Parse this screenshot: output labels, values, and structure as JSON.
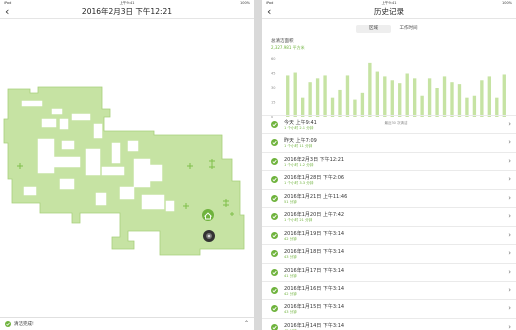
{
  "left": {
    "status": {
      "carrier": "iPad",
      "time": "上午9:41",
      "battery": "100%"
    },
    "nav": {
      "back": "‹",
      "title": "2016年2月3日 下午12:21"
    },
    "bottom": {
      "message": "清洁完成!",
      "chevron": "⌃"
    }
  },
  "right": {
    "status": {
      "carrier": "iPad",
      "time": "上午9:41",
      "battery": "100%"
    },
    "nav": {
      "back": "‹",
      "title": "历史记录"
    },
    "tabs": [
      "区域",
      "工作时间"
    ],
    "summary": {
      "label": "总清洁面积",
      "value": "2,327.981 平方米"
    },
    "chart_data": {
      "type": "bar",
      "ylim": [
        0,
        60
      ],
      "yticks": [
        "60",
        "45",
        "30",
        "15",
        "0"
      ],
      "xlabel": "最近30 次清洁",
      "values": [
        43,
        46,
        20,
        36,
        40,
        43,
        20,
        28,
        43,
        18,
        25,
        56,
        47,
        42,
        38,
        35,
        45,
        40,
        22,
        40,
        30,
        42,
        36,
        34,
        20,
        22,
        38,
        42,
        20,
        44
      ]
    },
    "list": [
      {
        "title": "今天 上午9:41",
        "sub": "1 个小时 2.1 分钟"
      },
      {
        "title": "昨天 上午7:09",
        "sub": "1 个小时 11 分钟"
      },
      {
        "title": "2016年2月3日 下午12:21",
        "sub": "1 个小时 1.2 分钟"
      },
      {
        "title": "2016年1月28日 下午2:06",
        "sub": "1 个小时 3.3 分钟"
      },
      {
        "title": "2016年1月21日 上午11:46",
        "sub": "51 分钟"
      },
      {
        "title": "2016年1月20日 上午7:42",
        "sub": "1 个小时 21 分钟"
      },
      {
        "title": "2016年1月19日 下午3:14",
        "sub": "42 分钟"
      },
      {
        "title": "2016年1月18日 下午3:14",
        "sub": "43 分钟"
      },
      {
        "title": "2016年1月17日 下午3:14",
        "sub": "41 分钟"
      },
      {
        "title": "2016年1月16日 下午3:14",
        "sub": "42 分钟"
      },
      {
        "title": "2016年1月15日 下午3:14",
        "sub": "43 分钟"
      },
      {
        "title": "2016年1月14日 下午3:14",
        "sub": "42 分钟"
      }
    ]
  },
  "colors": {
    "accent": "#6fb33d",
    "map_fill": "#c6e3a3"
  }
}
